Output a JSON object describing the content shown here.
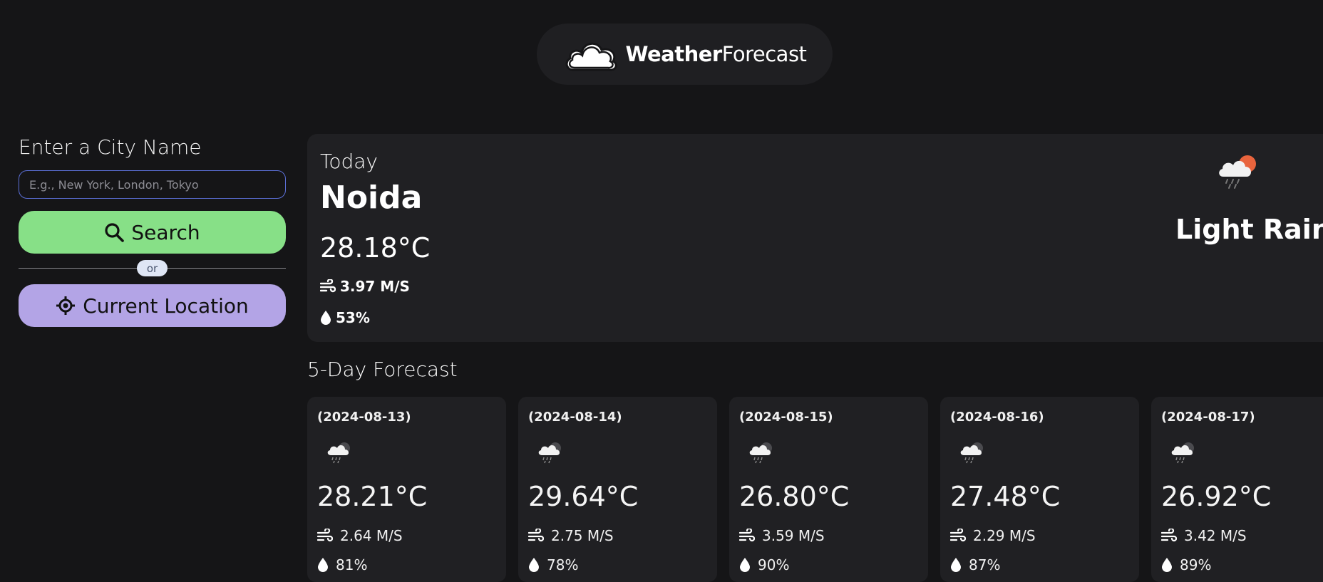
{
  "header": {
    "brand_bold": "Weather",
    "brand_light": "Forecast",
    "icon": "cloud-icon"
  },
  "sidebar": {
    "city_label": "Enter a City Name",
    "city_input": {
      "value": "",
      "placeholder": "E.g., New York, London, Tokyo"
    },
    "search_label": "Search",
    "or_label": "or",
    "location_label": "Current Location",
    "colors": {
      "search": "#87e087",
      "location": "#b3a4e6",
      "input_border": "#5b6fd6"
    }
  },
  "today": {
    "label": "Today",
    "city": "Noida",
    "temp": "28.18°C",
    "wind": "3.97 M/S",
    "humidity": "53%",
    "description": "Light Rain",
    "icon": "light-rain-icon"
  },
  "forecast": {
    "title": "5-Day Forecast",
    "days": [
      {
        "date": "(2024-08-13)",
        "temp": "28.21°C",
        "wind": "2.64 M/S",
        "humidity": "81%",
        "icon": "rain-cloud-icon"
      },
      {
        "date": "(2024-08-14)",
        "temp": "29.64°C",
        "wind": "2.75 M/S",
        "humidity": "78%",
        "icon": "rain-cloud-icon"
      },
      {
        "date": "(2024-08-15)",
        "temp": "26.80°C",
        "wind": "3.59 M/S",
        "humidity": "90%",
        "icon": "rain-cloud-icon"
      },
      {
        "date": "(2024-08-16)",
        "temp": "27.48°C",
        "wind": "2.29 M/S",
        "humidity": "87%",
        "icon": "rain-cloud-icon"
      },
      {
        "date": "(2024-08-17)",
        "temp": "26.92°C",
        "wind": "3.42 M/S",
        "humidity": "89%",
        "icon": "rain-cloud-icon"
      }
    ]
  }
}
